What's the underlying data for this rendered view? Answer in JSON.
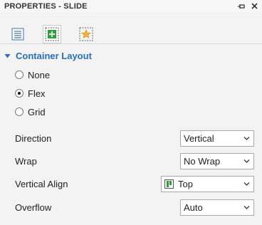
{
  "panel": {
    "title": "PROPERTIES - SLIDE",
    "pin_icon": "pin-icon",
    "close_icon": "close-icon"
  },
  "tabs": [
    {
      "icon": "list-properties-icon",
      "active": false
    },
    {
      "icon": "container-layout-icon",
      "active": true
    },
    {
      "icon": "star-effects-icon",
      "active": false
    }
  ],
  "section": {
    "title": "Container Layout",
    "expanded": true
  },
  "layout_options": [
    {
      "label": "None",
      "checked": false
    },
    {
      "label": "Flex",
      "checked": true
    },
    {
      "label": "Grid",
      "checked": false
    }
  ],
  "properties": {
    "direction": {
      "label": "Direction",
      "value": "Vertical"
    },
    "wrap": {
      "label": "Wrap",
      "value": "No Wrap"
    },
    "vertical_align": {
      "label": "Vertical Align",
      "value": "Top",
      "icon": "align-top-icon"
    },
    "overflow": {
      "label": "Overflow",
      "value": "Auto"
    }
  },
  "colors": {
    "accent": "#2a6dbe",
    "active_tab_icon": "#2e9e3a"
  }
}
